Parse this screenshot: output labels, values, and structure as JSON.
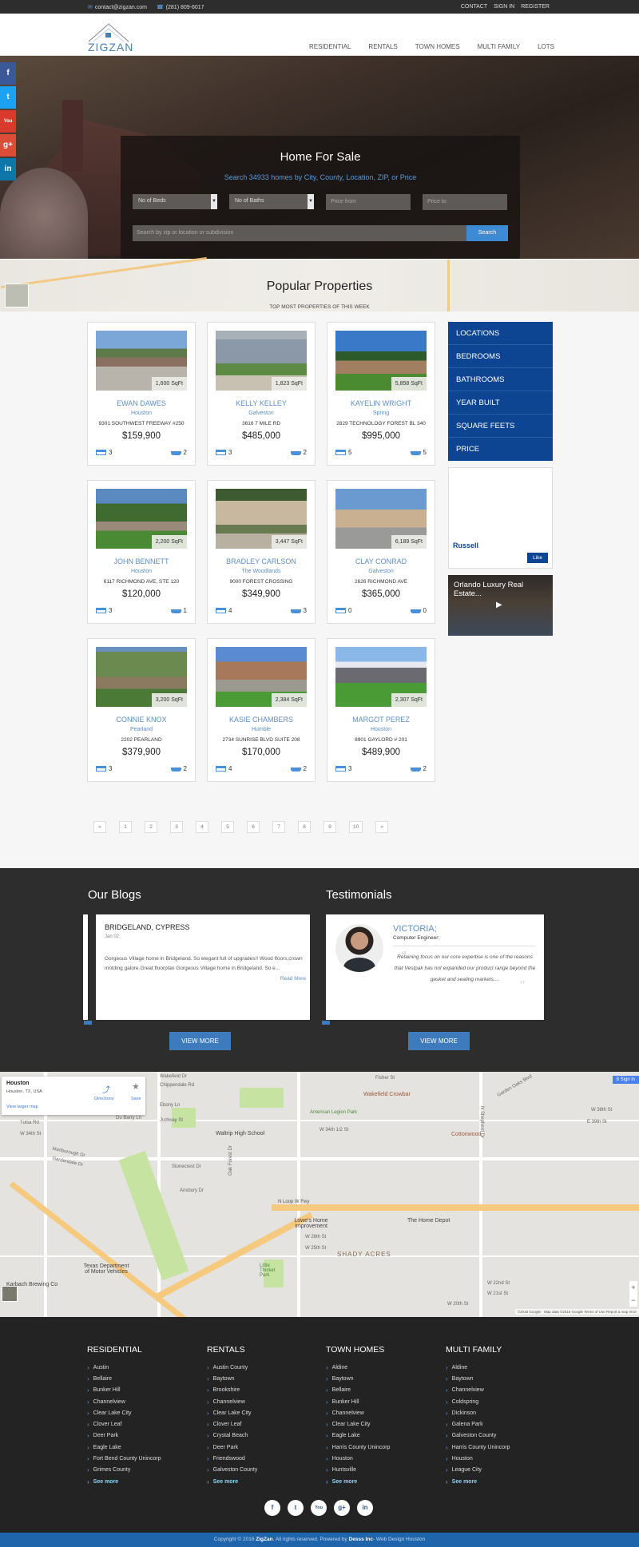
{
  "topbar": {
    "email": "contact@zigzan.com",
    "phone": "(281) 809-6017",
    "links": [
      "CONTACT",
      "SIGN IN",
      "REGISTER"
    ]
  },
  "header": {
    "logo_text": "ZIGZAN",
    "nav": [
      "RESIDENTIAL",
      "RENTALS",
      "TOWN HOMES",
      "MULTI FAMILY",
      "LOTS"
    ]
  },
  "social_side": [
    "f",
    "t",
    "You",
    "g+",
    "in"
  ],
  "hero": {
    "title": "Home For Sale",
    "subtitle": "Search 34933 homes by City, County, Location, ZIP, or Price",
    "beds_select": "No of Beds",
    "baths_select": "No of Baths",
    "price_from_placeholder": "Price from",
    "price_to_placeholder": "Price to",
    "search_placeholder": "Search by zip or location or subdivision",
    "search_button": "Search"
  },
  "popular": {
    "title": "Popular Properties",
    "subtitle": "TOP MOST PROPERTIES OF THIS WEEK",
    "properties": [
      {
        "name": "EWAN DAWES",
        "city": "Houston",
        "address": "9301 SOUTHWEST FREEWAY #250",
        "price": "$159,900",
        "sqft": "1,600 SqFt",
        "beds": "3",
        "baths": "2"
      },
      {
        "name": "KELLY KELLEY",
        "city": "Galveston",
        "address": "3616 7 MILE RD",
        "price": "$485,000",
        "sqft": "1,823 SqFt",
        "beds": "3",
        "baths": "2"
      },
      {
        "name": "KAYELIN WRIGHT",
        "city": "Spring",
        "address": "2829 TECHNOLOGY FOREST BL 340",
        "price": "$995,000",
        "sqft": "5,858 SqFt",
        "beds": "5",
        "baths": "5"
      },
      {
        "name": "JOHN BENNETT",
        "city": "Houston",
        "address": "6117 RICHMOND AVE, STE 120",
        "price": "$120,000",
        "sqft": "2,200 SqFt",
        "beds": "3",
        "baths": "1"
      },
      {
        "name": "BRADLEY CARLSON",
        "city": "The Woodlands",
        "address": "9000 FOREST CROSSING",
        "price": "$349,900",
        "sqft": "3,447 SqFt",
        "beds": "4",
        "baths": "3"
      },
      {
        "name": "CLAY CONRAD",
        "city": "Galveston",
        "address": "2626 RICHMOND AVE",
        "price": "$365,000",
        "sqft": "6,189 SqFt",
        "beds": "0",
        "baths": "0"
      },
      {
        "name": "CONNIE KNOX",
        "city": "Pearland",
        "address": "2202 PEARLAND",
        "price": "$379,900",
        "sqft": "3,200 SqFt",
        "beds": "3",
        "baths": "2"
      },
      {
        "name": "KASIE CHAMBERS",
        "city": "Humble",
        "address": "2734 SUNRISE BLVD SUITE 208",
        "price": "$170,000",
        "sqft": "2,384 SqFt",
        "beds": "4",
        "baths": "2"
      },
      {
        "name": "MARGOT PEREZ",
        "city": "Houston",
        "address": "8901 GAYLORD # 201",
        "price": "$489,900",
        "sqft": "2,307 SqFt",
        "beds": "3",
        "baths": "2"
      }
    ]
  },
  "sidebar": {
    "menu": [
      "LOCATIONS",
      "BEDROOMS",
      "BATHROOMS",
      "YEAR BUILT",
      "SQUARE FEETS",
      "PRICE"
    ],
    "fb_name": "Russell",
    "fb_like": "Like",
    "video_title": "Orlando Luxury Real Estate..."
  },
  "pagination": [
    "«",
    "1",
    "2",
    "3",
    "4",
    "5",
    "6",
    "7",
    "8",
    "9",
    "10",
    "»"
  ],
  "blogs": {
    "heading": "Our Blogs",
    "title": "BRIDGELAND, CYPRESS",
    "date": "Jan 02",
    "excerpt": "Gorgeous Village home in Bridgeland. So elegant full of upgrades!! Wood floors,crown molding galore.Great floorplan Gorgeous Village home in Bridgeland. So e...",
    "read_more": "Read More",
    "view_more": "VIEW MORE"
  },
  "testimonials": {
    "heading": "Testimonials",
    "name": "VICTORIA;",
    "role": "Computer Engineer;",
    "quote": "Retaining focus on our core expertise is one of the reasons that Vestpak has not expanded our product range beyond the gasket and sealing markets....",
    "view_more": "VIEW MORE"
  },
  "map": {
    "place": "Houston",
    "address": "Houston, TX, USA",
    "directions": "Directions",
    "save": "Save",
    "view_larger": "View larger map",
    "sign_in": "Sign in",
    "footer": "©2016 Google · Map data ©2016 Google   Terms of Use   Report a map error",
    "labels": [
      "Wakefield Dr",
      "Chippendale Rd",
      "Ebony Ln",
      "Judiway St",
      "Du Barry Ln",
      "Tulsa Rd",
      "W 34th St",
      "Marlborough Dr",
      "Gardendale Dr",
      "Waltrip High School",
      "American Legion Park",
      "Wakefield Crowbar",
      "Cottonwood",
      "W 34th 1/2 St",
      "Stonecrest Dr",
      "Oak Forest Dr",
      "Ansbury Dr",
      "N Loop W Fwy",
      "Lowe's Home Improvement",
      "The Home Depot",
      "SHADY ACRES",
      "W 26th St",
      "W 25th St",
      "W 22nd St",
      "W 21st St",
      "W 20th St",
      "Texas Department of Motor Vehicles",
      "Karbach Brewing Co",
      "Little Thicket Park",
      "N Shepherd Dr",
      "W 38th St",
      "E 39th St",
      "Fisher St",
      "Garden Oaks Blvd"
    ]
  },
  "footer": {
    "columns": [
      {
        "title": "RESIDENTIAL",
        "items": [
          "Austin",
          "Bellaire",
          "Bunker Hill",
          "Channelview",
          "Clear Lake City",
          "Clover Leaf",
          "Deer Park",
          "Eagle Lake",
          "Fort Bend County Unincorp",
          "Grimes County"
        ],
        "more": "See more"
      },
      {
        "title": "RENTALS",
        "items": [
          "Austin County",
          "Baytown",
          "Brookshire",
          "Channelview",
          "Clear Lake City",
          "Clover Leaf",
          "Crystal Beach",
          "Deer Park",
          "Friendswood",
          "Galveston County"
        ],
        "more": "See more"
      },
      {
        "title": "TOWN HOMES",
        "items": [
          "Aldine",
          "Baytown",
          "Bellaire",
          "Bunker Hill",
          "Channelview",
          "Clear Lake City",
          "Eagle Lake",
          "Harris County Unincorp",
          "Houston",
          "Huntsville"
        ],
        "more": "See more"
      },
      {
        "title": "MULTI FAMILY",
        "items": [
          "Aldine",
          "Baytown",
          "Channelview",
          "Coldspring",
          "Dickinson",
          "Galena Park",
          "Galveston County",
          "Harris County Unincorp",
          "Houston",
          "League City"
        ],
        "more": "See more"
      }
    ],
    "social": [
      "f",
      "t",
      "You",
      "g+",
      "in"
    ],
    "copyright_pre": "Copyright © 2016 ",
    "brand": "ZigZan",
    "copyright_mid": ". All rights reserved. Powered by ",
    "powered": "Desss Inc",
    "copyright_post": "- Web Design Houston"
  },
  "colors": {
    "accent_blue": "#3d7bbd",
    "sidebar_blue": "#0d4592",
    "link_blue": "#5b8fc7",
    "dark_bg": "#2d2d2d"
  }
}
